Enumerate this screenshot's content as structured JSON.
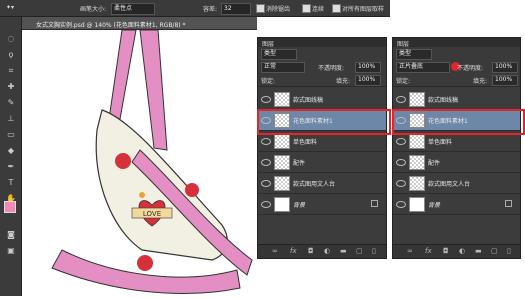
{
  "optbar": {
    "size_label": "画笔大小:",
    "size_value": "柔性点",
    "hardness_label": "容差:",
    "hardness_value": "32",
    "antialias_label": "消除锯齿",
    "contiguous_label": "连续",
    "sample_all_label": "对所有图层取样"
  },
  "doctab": {
    "title": "女式文胸实例.psd @ 140% (花色面料素材1, RGB/8) *"
  },
  "panel1": {
    "title": "图层",
    "kind": "类型",
    "blend_mode": "正常",
    "opacity_label": "不透明度:",
    "opacity_value": "100%",
    "lock_label": "锁定:",
    "fill_label": "填充:",
    "fill_value": "100%",
    "layers": [
      {
        "name": "款式图线稿"
      },
      {
        "name": "花色面料素材1"
      },
      {
        "name": "单色面料"
      },
      {
        "name": "配件"
      },
      {
        "name": "款式图用文人台"
      },
      {
        "name": "背景"
      }
    ]
  },
  "panel2": {
    "title": "图层",
    "kind": "类型",
    "blend_mode": "正片叠底",
    "opacity_label": "不透明度:",
    "opacity_value": "100%",
    "lock_label": "锁定:",
    "fill_label": "填充:",
    "fill_value": "100%",
    "layers": [
      {
        "name": "款式图线稿"
      },
      {
        "name": "花色面料素材1"
      },
      {
        "name": "单色面料"
      },
      {
        "name": "配件"
      },
      {
        "name": "款式图用文人台"
      },
      {
        "name": "背景"
      }
    ]
  },
  "canvas": {
    "love_text": "LOVE"
  },
  "colors": {
    "highlight": "#e0262a",
    "selected_layer": "#6c87a8",
    "strap": "#e48fc3",
    "foreground": "#f08ab5"
  },
  "icons": {
    "fx": "fx"
  }
}
